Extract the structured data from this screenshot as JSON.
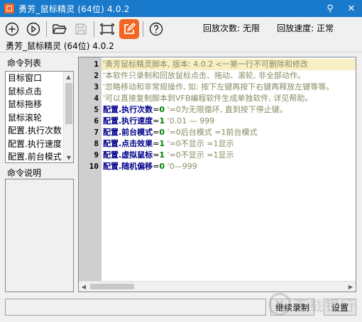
{
  "window": {
    "title": "勇芳_鼠标精灵 (64位) 4.0.2",
    "pin_glyph": "⚲",
    "close_glyph": "✕"
  },
  "toolbar": {
    "tools": [
      {
        "name": "add-icon"
      },
      {
        "name": "play-icon"
      },
      {
        "name": "open-folder-icon"
      },
      {
        "name": "save-icon"
      },
      {
        "name": "fullscreen-icon"
      },
      {
        "name": "edit-icon"
      },
      {
        "name": "help-icon"
      }
    ],
    "app_label": "勇芳_鼠标精灵 (64位) 4.0.2"
  },
  "settings": {
    "repeat_label": "回放次数:",
    "repeat_value": "无限",
    "speed_label": "回放速度:",
    "speed_value": "正常"
  },
  "command_list": {
    "title": "命令列表",
    "items": [
      "目标窗口",
      "鼠标点击",
      "鼠标拖移",
      "鼠标滚轮",
      "配置.执行次数",
      "配置.执行速度",
      "配置.前台模式"
    ]
  },
  "command_desc": {
    "title": "命令说明"
  },
  "editor": {
    "line_numbers": [
      "1",
      "2",
      "3",
      "4",
      "5",
      "6",
      "7",
      "8",
      "9",
      "10"
    ],
    "lines": [
      {
        "comment": "'勇芳鼠标精灵脚本, 版本: 4.0.2  <一第一行不可删除和修改"
      },
      {
        "comment": "'本软件只录制和回放鼠标点击、拖动、滚轮, 非全部动作。"
      },
      {
        "comment": "'忽略移动和非常规操作, 如: 按下左键再按下右键再释放左键等等。"
      },
      {
        "comment": "'可以直接复制脚本到VFB编程软件生成单独软件, 详见帮助。"
      },
      {
        "kw": "配置.执行次数",
        "eq": "=",
        "num": "0",
        "comment": " '=0为无限循环, 直到按下停止键。"
      },
      {
        "kw": "配置.执行速度",
        "eq": "=",
        "num": "1",
        "comment": " '0.01 — 999"
      },
      {
        "kw": "配置.前台模式",
        "eq": "=",
        "num": "0",
        "comment": " '=0后台模式 =1前台模式"
      },
      {
        "kw": "配置.点击效果",
        "eq": "=",
        "num": "1",
        "comment": " '=0不显示 =1显示"
      },
      {
        "kw": "配置.虚拟鼠标",
        "eq": "=",
        "num": "1",
        "comment": " '=0不显示 =1显示"
      },
      {
        "kw": "配置.随机偏移",
        "eq": "=",
        "num": "0",
        "comment": " '0—999"
      }
    ]
  },
  "buttons": {
    "continue_label": "继续录制",
    "settings_label": "设置"
  },
  "watermark": {
    "logo": "X",
    "text": "下载银行"
  },
  "colors": {
    "titlebar": "#1979ca",
    "accent": "#f26522",
    "highlight_line": "#f8efc4",
    "keyword": "#00008b",
    "number": "#008000"
  }
}
